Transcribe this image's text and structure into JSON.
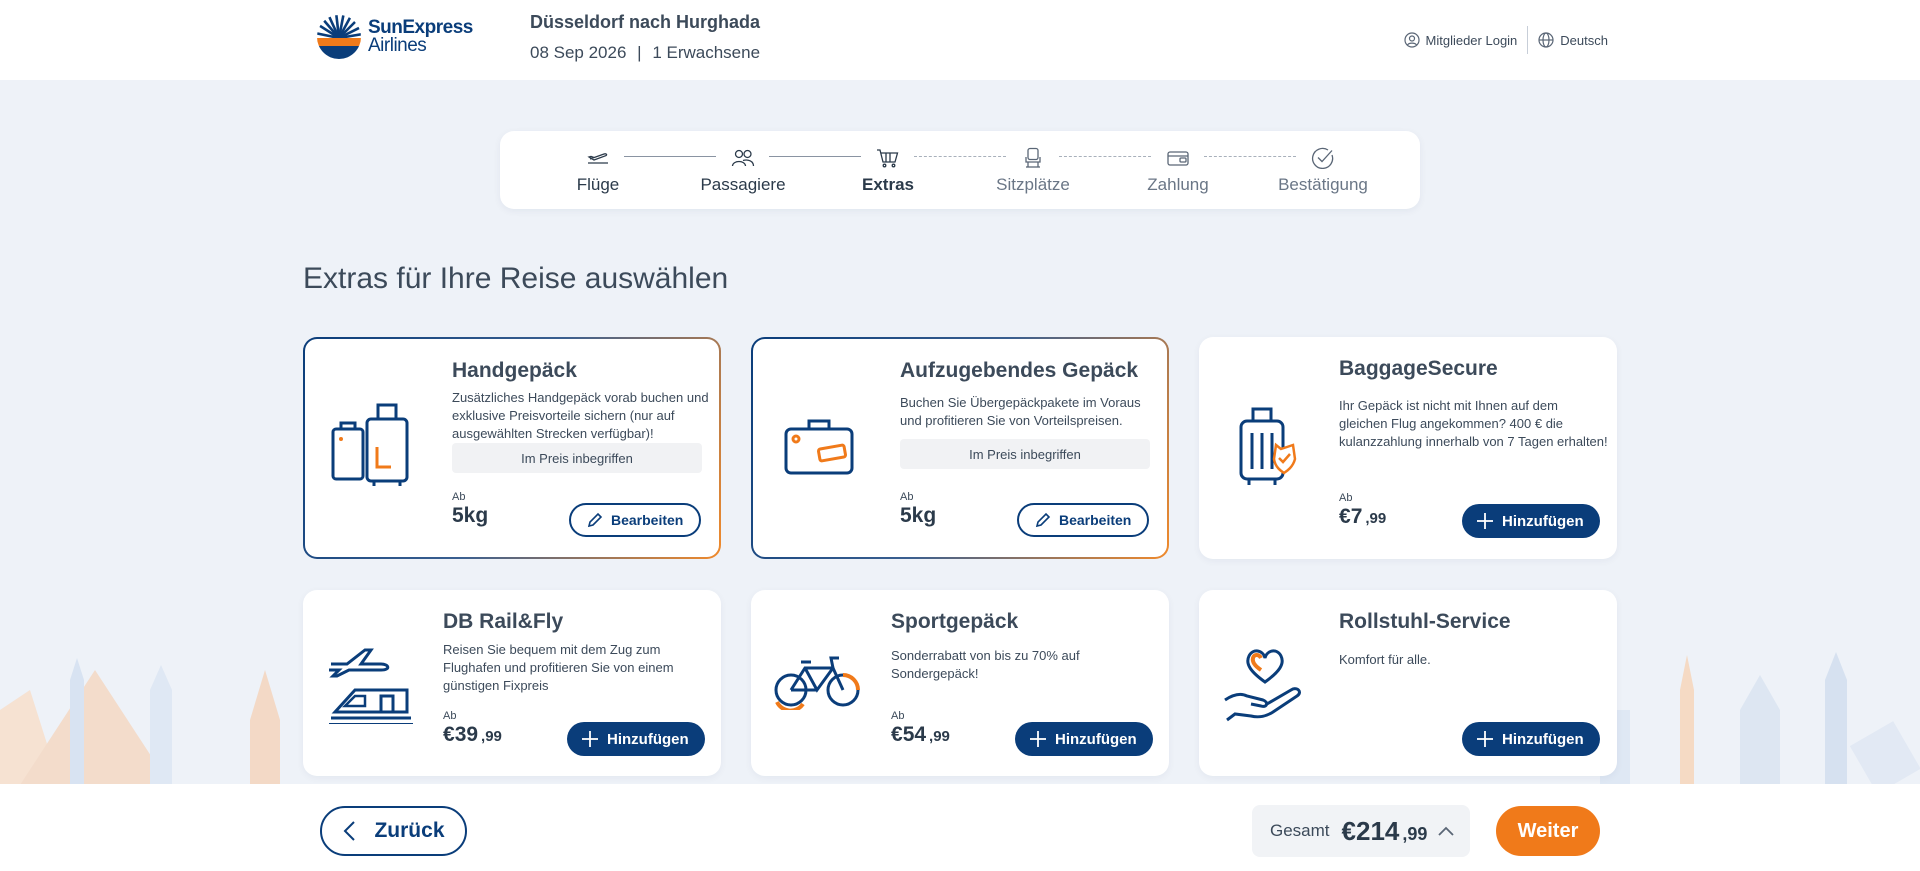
{
  "brand": {
    "name_line1": "SunExpress",
    "name_line2": "Airlines"
  },
  "trip": {
    "route": "Düsseldorf nach Hurghada",
    "date": "08 Sep 2026",
    "separator": "|",
    "passengers": "1 Erwachsene"
  },
  "top_links": {
    "login": "Mitglieder Login",
    "language": "Deutsch"
  },
  "stepper": {
    "steps": [
      {
        "label": "Flüge",
        "state": "done",
        "icon": "plane-takeoff-icon"
      },
      {
        "label": "Passagiere",
        "state": "done",
        "icon": "passengers-icon"
      },
      {
        "label": "Extras",
        "state": "active",
        "icon": "cart-icon"
      },
      {
        "label": "Sitzplätze",
        "state": "future",
        "icon": "seat-icon"
      },
      {
        "label": "Zahlung",
        "state": "future",
        "icon": "wallet-icon"
      },
      {
        "label": "Bestätigung",
        "state": "future",
        "icon": "check-circle-icon"
      }
    ]
  },
  "heading": "Extras für Ihre Reise auswählen",
  "cards": [
    {
      "title": "Handgepäck",
      "desc_lines": [
        "Zusätzliches Handgepäck vorab buchen und",
        "exklusive Preisvorteile sichern (nur auf",
        "ausgewählten Strecken verfügbar)!"
      ],
      "included": "Im Preis inbegriffen",
      "ab": "Ab",
      "price": "5kg",
      "button": "Bearbeiten",
      "icon": "cabin-luggage-icon"
    },
    {
      "title": "Aufzugebendes Gepäck",
      "desc_lines": [
        "Buchen Sie Übergepäckpakete im Voraus",
        "und profitieren Sie von Vorteilspreisen."
      ],
      "included": "Im Preis inbegriffen",
      "ab": "Ab",
      "price": "5kg",
      "button": "Bearbeiten",
      "icon": "checked-bag-icon"
    },
    {
      "title": "BaggageSecure",
      "desc_lines": [
        "Ihr Gepäck ist nicht mit Ihnen auf dem",
        "gleichen Flug angekommen? 400 € die",
        "kulanzzahlung innerhalb von 7 Tagen erhalten!"
      ],
      "ab": "Ab",
      "price_currency": "€",
      "price_main": "7",
      "price_cent": ",99",
      "button": "Hinzufügen",
      "icon": "baggage-secure-icon"
    },
    {
      "title": "DB Rail&Fly",
      "desc_lines": [
        "Reisen Sie bequem mit dem Zug zum",
        "Flughafen und profitieren Sie von einem",
        "günstigen Fixpreis"
      ],
      "ab": "Ab",
      "price_currency": "€",
      "price_main": "39",
      "price_cent": ",99",
      "button": "Hinzufügen",
      "icon": "rail-fly-icon"
    },
    {
      "title": "Sportgepäck",
      "desc_lines": [
        "Sonderrabatt von bis zu 70% auf",
        "Sondergepäck!"
      ],
      "ab": "Ab",
      "price_currency": "€",
      "price_main": "54",
      "price_cent": ",99",
      "button": "Hinzufügen",
      "icon": "bicycle-icon"
    },
    {
      "title": "Rollstuhl-Service",
      "desc_lines": [
        "Komfort für alle."
      ],
      "button": "Hinzufügen",
      "icon": "heart-hand-icon"
    }
  ],
  "footer": {
    "back": "Zurück",
    "total_label": "Gesamt",
    "total_currency": "€",
    "total_main": "214",
    "total_cent": ",99",
    "next": "Weiter"
  },
  "colors": {
    "brand_blue": "#0a3d7a",
    "brand_orange": "#f07a1a",
    "background": "#eef2f8"
  }
}
